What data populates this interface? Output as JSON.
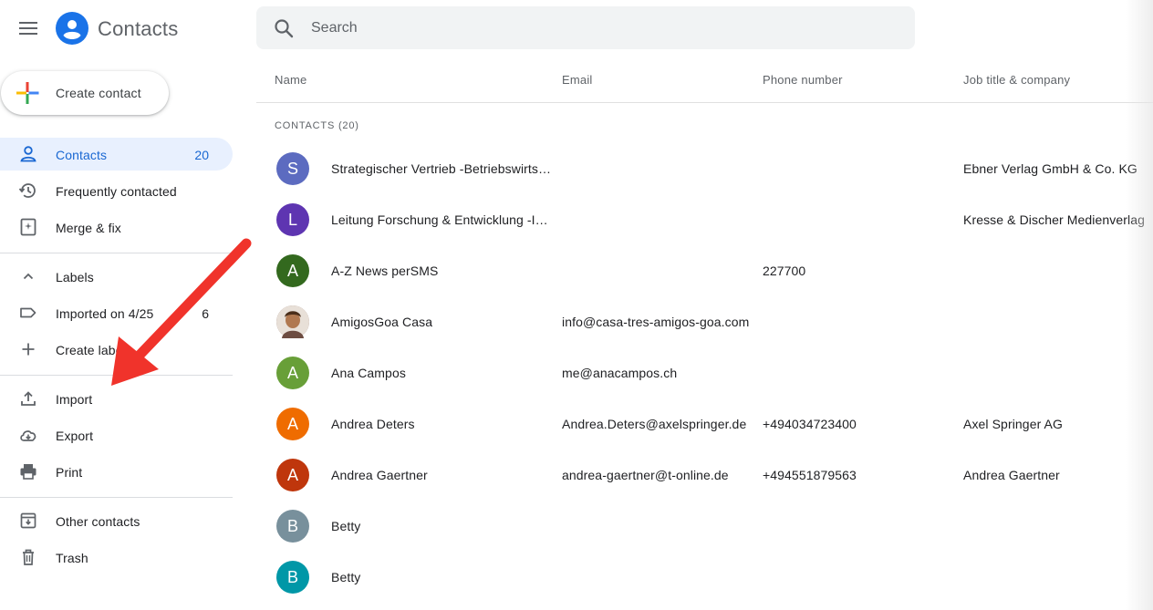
{
  "app": {
    "title": "Contacts"
  },
  "search": {
    "placeholder": "Search"
  },
  "create_button": {
    "label": "Create contact"
  },
  "sidebar": {
    "primary": [
      {
        "label": "Contacts",
        "count": "20",
        "icon": "person-icon",
        "active": true
      },
      {
        "label": "Frequently contacted",
        "icon": "history-icon"
      },
      {
        "label": "Merge & fix",
        "icon": "merge-icon"
      }
    ],
    "labels_header": {
      "label": "Labels",
      "icon": "chevron-up-icon"
    },
    "labels": [
      {
        "label": "Imported on 4/25",
        "count": "6",
        "icon": "label-icon"
      },
      {
        "label": "Create label",
        "icon": "plus-icon"
      }
    ],
    "actions": [
      {
        "label": "Import",
        "icon": "upload-icon"
      },
      {
        "label": "Export",
        "icon": "cloud-download-icon"
      },
      {
        "label": "Print",
        "icon": "printer-icon"
      }
    ],
    "other": [
      {
        "label": "Other contacts",
        "icon": "archive-icon"
      },
      {
        "label": "Trash",
        "icon": "trash-icon"
      }
    ]
  },
  "table": {
    "headers": {
      "name": "Name",
      "email": "Email",
      "phone": "Phone number",
      "job": "Job title & company"
    },
    "section_label": "CONTACTS (20)",
    "rows": [
      {
        "initial": "S",
        "color": "#5c6bc0",
        "name": "Strategischer Vertrieb -Betriebswirtschaft",
        "email": "",
        "phone": "",
        "job": "Ebner Verlag GmbH & Co. KG"
      },
      {
        "initial": "L",
        "color": "#5e35b1",
        "name": "Leitung Forschung & Entwicklung -Innovation",
        "email": "",
        "phone": "",
        "job": "Kresse & Discher Medienverlag"
      },
      {
        "initial": "A",
        "color": "#33691e",
        "name": "A-Z News perSMS",
        "email": "",
        "phone": "227700",
        "job": ""
      },
      {
        "initial": "",
        "color": "#8d6e63",
        "photo": true,
        "name": "AmigosGoa Casa",
        "email": "info@casa-tres-amigos-goa.com",
        "phone": "",
        "job": ""
      },
      {
        "initial": "A",
        "color": "#689f38",
        "name": "Ana Campos",
        "email": "me@anacampos.ch",
        "phone": "",
        "job": ""
      },
      {
        "initial": "A",
        "color": "#ef6c00",
        "name": "Andrea Deters",
        "email": "Andrea.Deters@axelspringer.de",
        "phone": "+494034723400",
        "job": "Axel Springer AG"
      },
      {
        "initial": "A",
        "color": "#bf360c",
        "name": "Andrea Gaertner",
        "email": "andrea-gaertner@t-online.de",
        "phone": "+494551879563",
        "job": "Andrea Gaertner"
      },
      {
        "initial": "B",
        "color": "#78909c",
        "name": "Betty",
        "email": "",
        "phone": "",
        "job": ""
      },
      {
        "initial": "B",
        "color": "#0097a7",
        "name": "Betty",
        "email": "",
        "phone": "",
        "job": ""
      }
    ]
  },
  "annotation": {
    "color": "#f0332b"
  }
}
